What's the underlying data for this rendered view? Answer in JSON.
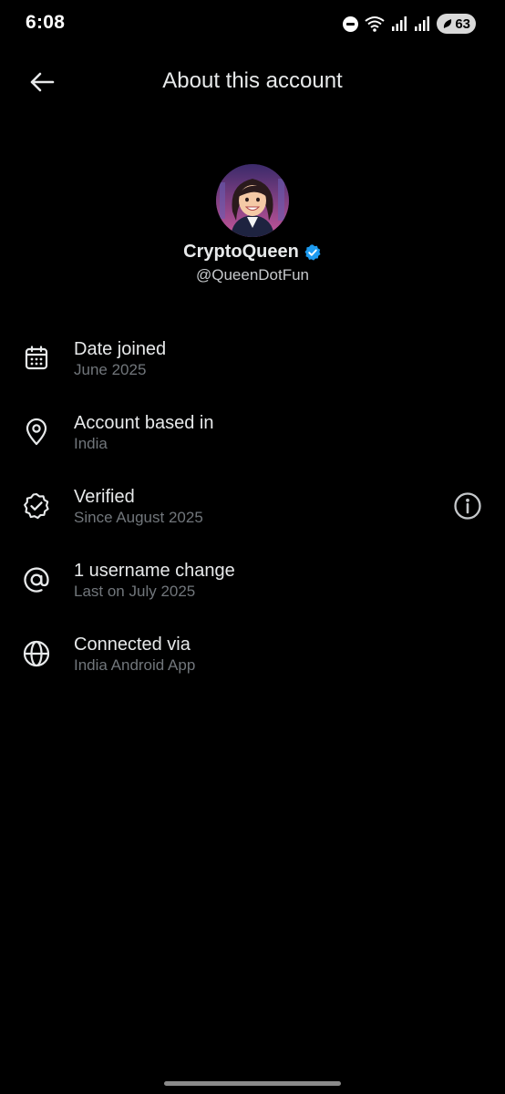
{
  "status_bar": {
    "time": "6:08",
    "battery": "63",
    "icons": [
      "do-not-disturb-icon",
      "wifi-icon",
      "signal-icon",
      "signal-icon",
      "battery-icon"
    ]
  },
  "header": {
    "title": "About this account",
    "back_icon": "arrow-left-icon"
  },
  "profile": {
    "display_name": "CryptoQueen",
    "handle": "@QueenDotFun",
    "verified": true,
    "badge_color": "#1d9bf0"
  },
  "info_items": [
    {
      "icon": "calendar-icon",
      "title": "Date joined",
      "subtitle": "June 2025"
    },
    {
      "icon": "location-pin-icon",
      "title": "Account based in",
      "subtitle": "India"
    },
    {
      "icon": "verified-badge-icon",
      "title": "Verified",
      "subtitle": "Since August 2025",
      "action_icon": "info-icon"
    },
    {
      "icon": "at-sign-icon",
      "title": "1 username change",
      "subtitle": "Last on July 2025"
    },
    {
      "icon": "globe-icon",
      "title": "Connected via",
      "subtitle": "India Android App"
    }
  ],
  "colors": {
    "background": "#000000",
    "text_primary": "#e7e9ea",
    "text_secondary": "#71767b",
    "accent": "#1d9bf0"
  }
}
